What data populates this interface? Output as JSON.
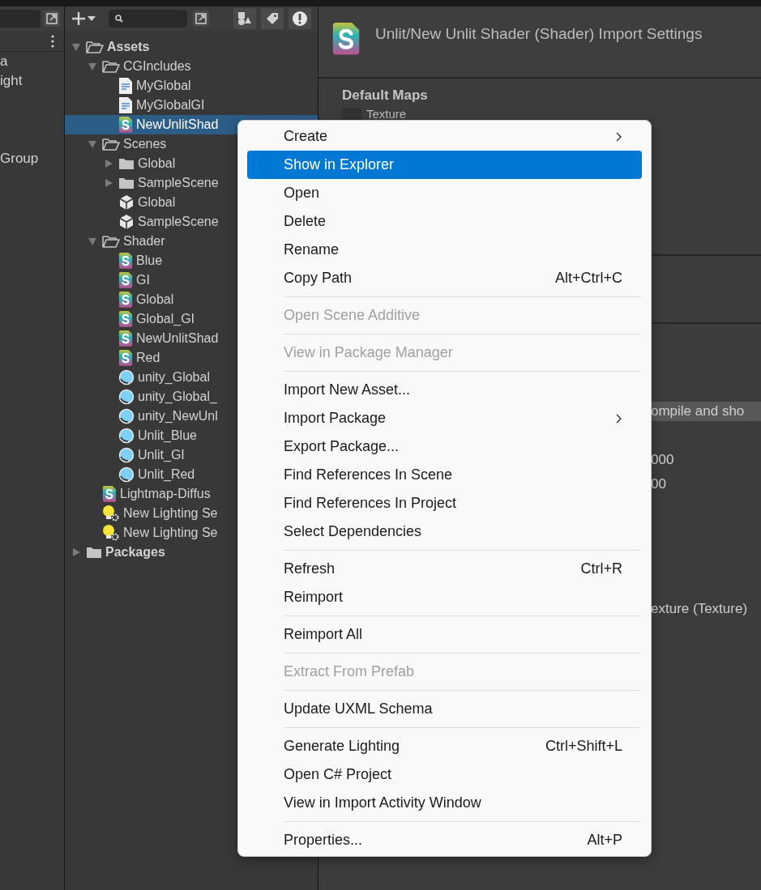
{
  "hierarchy": {
    "items": [
      "a",
      "ight",
      "Group"
    ]
  },
  "project": {
    "tree": [
      {
        "label": "Assets",
        "kind": "folder",
        "bold": true,
        "selected": false,
        "expanded": true,
        "children": [
          {
            "label": "CGIncludes",
            "kind": "folder",
            "selected": false,
            "expanded": true,
            "children": [
              {
                "label": "MyGlobal",
                "kind": "doc",
                "selected": false
              },
              {
                "label": "MyGlobalGI",
                "kind": "doc",
                "selected": false
              },
              {
                "label": "NewUnlitShad",
                "kind": "shader",
                "selected": true
              }
            ]
          },
          {
            "label": "Scenes",
            "kind": "folder",
            "selected": false,
            "expanded": true,
            "children": [
              {
                "label": "Global",
                "kind": "folder",
                "selected": false,
                "expanded": false
              },
              {
                "label": "SampleScene",
                "kind": "folder",
                "selected": false,
                "expanded": false
              },
              {
                "label": "Global",
                "kind": "scene",
                "selected": false
              },
              {
                "label": "SampleScene",
                "kind": "scene",
                "selected": false
              }
            ]
          },
          {
            "label": "Shader",
            "kind": "folder",
            "selected": false,
            "expanded": true,
            "children": [
              {
                "label": "Blue",
                "kind": "shader",
                "selected": false
              },
              {
                "label": "GI",
                "kind": "shader",
                "selected": false
              },
              {
                "label": "Global",
                "kind": "shader",
                "selected": false
              },
              {
                "label": "Global_GI",
                "kind": "shader",
                "selected": false
              },
              {
                "label": "NewUnlitShad",
                "kind": "shader",
                "selected": false
              },
              {
                "label": "Red",
                "kind": "shader",
                "selected": false
              },
              {
                "label": "unity_Global",
                "kind": "material",
                "selected": false
              },
              {
                "label": "unity_Global_",
                "kind": "material",
                "selected": false
              },
              {
                "label": "unity_NewUnl",
                "kind": "material",
                "selected": false
              },
              {
                "label": "Unlit_Blue",
                "kind": "material",
                "selected": false
              },
              {
                "label": "Unlit_GI",
                "kind": "material",
                "selected": false
              },
              {
                "label": "Unlit_Red",
                "kind": "material",
                "selected": false
              }
            ]
          },
          {
            "label": "Lightmap-Diffus",
            "kind": "shader",
            "selected": false
          },
          {
            "label": "New Lighting Se",
            "kind": "lighting",
            "selected": false
          },
          {
            "label": "New Lighting Se",
            "kind": "lighting",
            "selected": false
          }
        ]
      },
      {
        "label": "Packages",
        "kind": "folder",
        "bold": true,
        "selected": false,
        "expanded": false
      }
    ]
  },
  "inspector": {
    "title": "Unlit/New Unlit Shader (Shader) Import Settings",
    "section": "Default Maps",
    "texture_label": "Texture",
    "fragments": [
      {
        "text": "ompile and sho",
        "highlighted": true
      },
      {
        "text": "000",
        "highlighted": false
      },
      {
        "text": "00",
        "highlighted": false
      },
      {
        "text": "exture (Texture)",
        "highlighted": false
      }
    ]
  },
  "context_menu": [
    {
      "kind": "item",
      "label": "Create",
      "submenu": true,
      "selected": false,
      "disabled": false
    },
    {
      "kind": "item",
      "label": "Show in Explorer",
      "selected": true,
      "disabled": false
    },
    {
      "kind": "item",
      "label": "Open",
      "selected": false,
      "disabled": false
    },
    {
      "kind": "item",
      "label": "Delete",
      "selected": false,
      "disabled": false
    },
    {
      "kind": "item",
      "label": "Rename",
      "selected": false,
      "disabled": false
    },
    {
      "kind": "item",
      "label": "Copy Path",
      "shortcut": "Alt+Ctrl+C",
      "selected": false,
      "disabled": false
    },
    {
      "kind": "separator"
    },
    {
      "kind": "item",
      "label": "Open Scene Additive",
      "selected": false,
      "disabled": true
    },
    {
      "kind": "separator"
    },
    {
      "kind": "item",
      "label": "View in Package Manager",
      "selected": false,
      "disabled": true
    },
    {
      "kind": "separator"
    },
    {
      "kind": "item",
      "label": "Import New Asset...",
      "selected": false,
      "disabled": false
    },
    {
      "kind": "item",
      "label": "Import Package",
      "submenu": true,
      "selected": false,
      "disabled": false
    },
    {
      "kind": "item",
      "label": "Export Package...",
      "selected": false,
      "disabled": false
    },
    {
      "kind": "item",
      "label": "Find References In Scene",
      "selected": false,
      "disabled": false
    },
    {
      "kind": "item",
      "label": "Find References In Project",
      "selected": false,
      "disabled": false
    },
    {
      "kind": "item",
      "label": "Select Dependencies",
      "selected": false,
      "disabled": false
    },
    {
      "kind": "separator"
    },
    {
      "kind": "item",
      "label": "Refresh",
      "shortcut": "Ctrl+R",
      "selected": false,
      "disabled": false
    },
    {
      "kind": "item",
      "label": "Reimport",
      "selected": false,
      "disabled": false
    },
    {
      "kind": "separator"
    },
    {
      "kind": "item",
      "label": "Reimport All",
      "selected": false,
      "disabled": false
    },
    {
      "kind": "separator"
    },
    {
      "kind": "item",
      "label": "Extract From Prefab",
      "selected": false,
      "disabled": true
    },
    {
      "kind": "separator"
    },
    {
      "kind": "item",
      "label": "Update UXML Schema",
      "selected": false,
      "disabled": false
    },
    {
      "kind": "separator"
    },
    {
      "kind": "item",
      "label": "Generate Lighting",
      "shortcut": "Ctrl+Shift+L",
      "selected": false,
      "disabled": false
    },
    {
      "kind": "item",
      "label": "Open C# Project",
      "selected": false,
      "disabled": false
    },
    {
      "kind": "item",
      "label": "View in Import Activity Window",
      "selected": false,
      "disabled": false
    },
    {
      "kind": "separator"
    },
    {
      "kind": "item",
      "label": "Properties...",
      "shortcut": "Alt+P",
      "selected": false,
      "disabled": false
    }
  ]
}
